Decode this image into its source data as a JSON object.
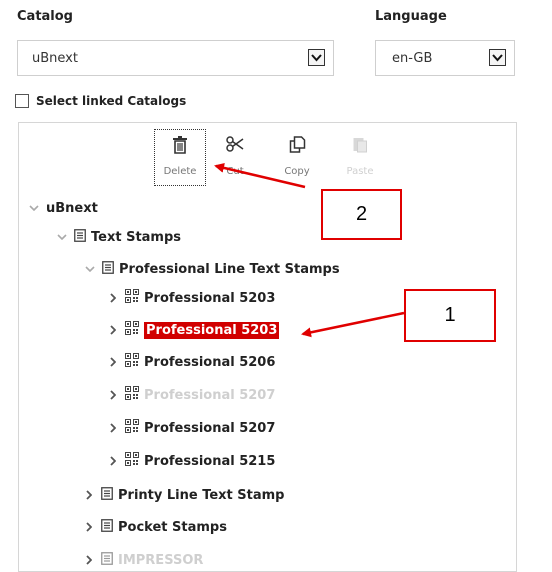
{
  "catalog": {
    "label": "Catalog",
    "value": "uBnext"
  },
  "language": {
    "label": "Language",
    "value": "en-GB"
  },
  "linked": {
    "label": "Select linked Catalogs",
    "checked": false
  },
  "toolbar": {
    "delete": "Delete",
    "cut": "Cut",
    "copy": "Copy",
    "paste": "Paste"
  },
  "tree": {
    "root": "uBnext",
    "text_stamps": "Text Stamps",
    "professional_line": "Professional Line Text Stamps",
    "items": [
      {
        "label": "Professional 5203",
        "state": "normal"
      },
      {
        "label": "Professional 5203",
        "state": "selected"
      },
      {
        "label": "Professional 5206",
        "state": "normal"
      },
      {
        "label": "Professional 5207",
        "state": "disabled"
      },
      {
        "label": "Professional 5207",
        "state": "normal"
      },
      {
        "label": "Professional 5215",
        "state": "normal"
      }
    ],
    "printy_line": "Printy Line Text Stamp",
    "pocket": "Pocket Stamps",
    "impressor": "IMPRESSOR"
  },
  "callouts": {
    "one": "1",
    "two": "2"
  },
  "colors": {
    "highlight": "#d10000",
    "annotation": "#e00000"
  }
}
